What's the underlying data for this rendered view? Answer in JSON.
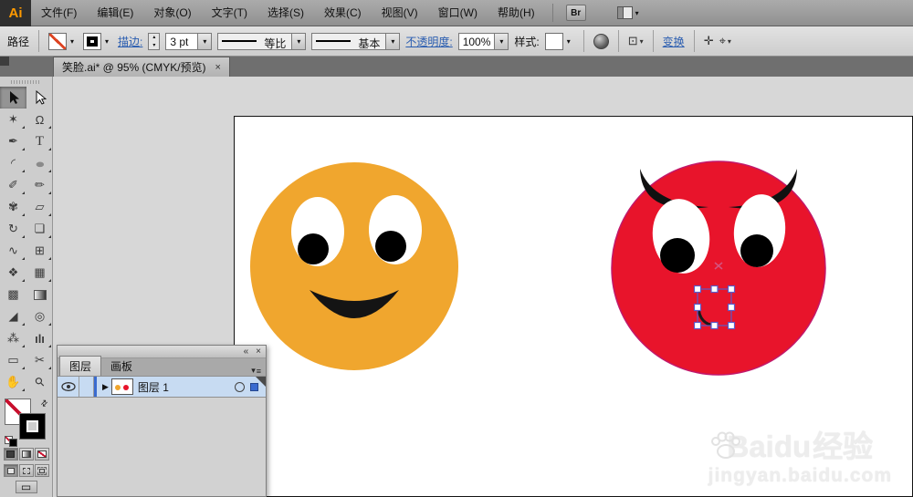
{
  "app": {
    "logo": "Ai",
    "bridge_label": "Br"
  },
  "menubar": {
    "items": [
      {
        "label": "文件(F)"
      },
      {
        "label": "编辑(E)"
      },
      {
        "label": "对象(O)"
      },
      {
        "label": "文字(T)"
      },
      {
        "label": "选择(S)"
      },
      {
        "label": "效果(C)"
      },
      {
        "label": "视图(V)"
      },
      {
        "label": "窗口(W)"
      },
      {
        "label": "帮助(H)"
      }
    ]
  },
  "controlbar": {
    "context_label": "路径",
    "stroke_link": "描边:",
    "stroke_weight": "3 pt",
    "profile_label": "等比",
    "brush_label": "基本",
    "opacity_link": "不透明度:",
    "opacity_value": "100%",
    "style_label": "样式:",
    "transform_link": "变换"
  },
  "document_tab": {
    "title": "笑脸.ai* @ 95% (CMYK/预览)"
  },
  "toolbar": {
    "tools": [
      {
        "name": "selection",
        "glyph": ""
      },
      {
        "name": "direct-selection",
        "glyph": ""
      },
      {
        "name": "magic-wand",
        "glyph": "✶"
      },
      {
        "name": "lasso",
        "glyph": "Ω"
      },
      {
        "name": "pen",
        "glyph": "✒"
      },
      {
        "name": "type",
        "glyph": "T"
      },
      {
        "name": "line-segment",
        "glyph": "◜"
      },
      {
        "name": "ellipse",
        "glyph": "●"
      },
      {
        "name": "paintbrush",
        "glyph": "✐"
      },
      {
        "name": "pencil",
        "glyph": "✏"
      },
      {
        "name": "blob-brush",
        "glyph": "✾"
      },
      {
        "name": "eraser",
        "glyph": "▱"
      },
      {
        "name": "rotate",
        "glyph": "↻"
      },
      {
        "name": "scale",
        "glyph": "❏"
      },
      {
        "name": "width",
        "glyph": "∿"
      },
      {
        "name": "free-transform",
        "glyph": "⊞"
      },
      {
        "name": "shape-builder",
        "glyph": "❖"
      },
      {
        "name": "perspective-grid",
        "glyph": "▦"
      },
      {
        "name": "mesh",
        "glyph": "▩"
      },
      {
        "name": "gradient",
        "glyph": ""
      },
      {
        "name": "eyedropper",
        "glyph": "◢"
      },
      {
        "name": "blend",
        "glyph": "◎"
      },
      {
        "name": "symbol-sprayer",
        "glyph": "⁂"
      },
      {
        "name": "column-graph",
        "glyph": "ılı"
      },
      {
        "name": "artboard",
        "glyph": "▭"
      },
      {
        "name": "slice",
        "glyph": "✂"
      },
      {
        "name": "hand",
        "glyph": "✋"
      },
      {
        "name": "zoom",
        "glyph": "⚲"
      }
    ]
  },
  "layers_panel": {
    "tabs": [
      {
        "label": "图层"
      },
      {
        "label": "画板"
      }
    ],
    "layer_name": "图层 1"
  },
  "canvas": {
    "smiley": {
      "face_color": "#F0A62E",
      "eye_color": "#FFFFFF",
      "pupil_color": "#000000",
      "mouth_color": "#141414"
    },
    "devil": {
      "face_color": "#E8142B",
      "outline_color": "#C2186B",
      "brow_color": "#111111",
      "eye_color": "#FFFFFF",
      "pupil_color": "#000000",
      "mouth_stroke": "#1A1A1A",
      "center_mark": "#D4537F"
    },
    "selection_color": "#5A5AC8",
    "selection_handle_fill": "#FFFFFF"
  },
  "watermark": {
    "brand": "Baidu",
    "suffix": "经验",
    "url": "jingyan.baidu.com"
  },
  "icons": {
    "dropdown": "▾",
    "stepper_up": "▴",
    "stepper_down": "▾",
    "close": "×",
    "collapse": "«",
    "panel_menu_arrow": "▾",
    "panel_menu_lines": "≡",
    "expand_arrow": "▶",
    "swap": "⇄",
    "select_similar": "⊡",
    "align": "✛",
    "isolate": "⌖",
    "screen_mode": "▭"
  }
}
